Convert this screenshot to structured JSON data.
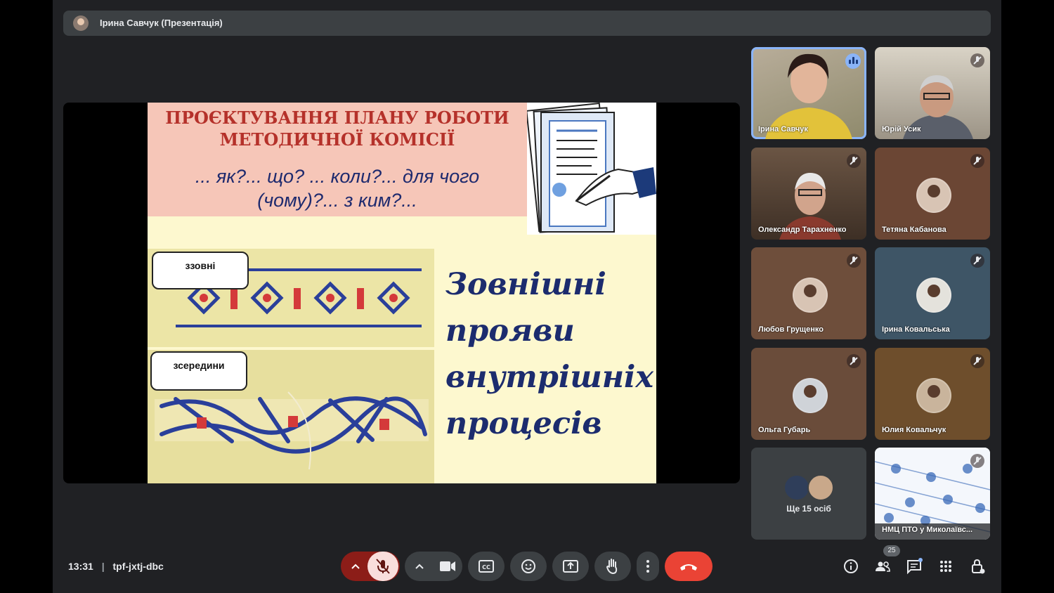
{
  "topbar": {
    "title": "Ірина Савчук (Презентація)"
  },
  "slide": {
    "title_line1": "ПРОЄКТУВАННЯ ПЛАНУ РОБОТИ",
    "title_line2": "МЕТОДИЧНОЇ КОМІСІЇ",
    "questions_line1": "... як?... що? ... коли?... для чого",
    "questions_line2": "(чому)?... з ким?...",
    "label_outside": "ззовні",
    "label_inside": "зсередини",
    "big_line1": "Зовнішні",
    "big_line2": "прояви",
    "big_line3": "внутрішніх",
    "big_line4": "процесів"
  },
  "participants": [
    {
      "name": "Ірина Савчук",
      "speaking": true
    },
    {
      "name": "Юрій Усик",
      "muted": true
    },
    {
      "name": "Олександр Тарахненко",
      "muted": true
    },
    {
      "name": "Тетяна Кабанова",
      "muted": true
    },
    {
      "name": "Любов Грущенко",
      "muted": true
    },
    {
      "name": "Ірина Ковальська",
      "muted": true
    },
    {
      "name": "Ольга Губарь",
      "muted": true
    },
    {
      "name": "Юлия Ковальчук",
      "muted": true
    },
    {
      "name": "Ще 15 осіб"
    },
    {
      "name": "НМЦ ПТО у Миколаївс...",
      "muted": true
    }
  ],
  "bottom": {
    "time": "13:31",
    "separator": "|",
    "meeting_code": "tpf-jxtj-dbc",
    "participant_count": "25"
  },
  "colors": {
    "background": "#202124",
    "control": "#3c4043",
    "end_call": "#ea4335",
    "mic_off_bg": "#f9dedc",
    "mic_off_group": "#8c1d18"
  },
  "icons": [
    "chevron-up-icon",
    "mic-off-icon",
    "camera-icon",
    "captions-icon",
    "emoji-icon",
    "present-icon",
    "raise-hand-icon",
    "more-vert-icon",
    "call-end-icon",
    "info-icon",
    "people-icon",
    "chat-icon",
    "activities-icon",
    "host-controls-icon"
  ]
}
